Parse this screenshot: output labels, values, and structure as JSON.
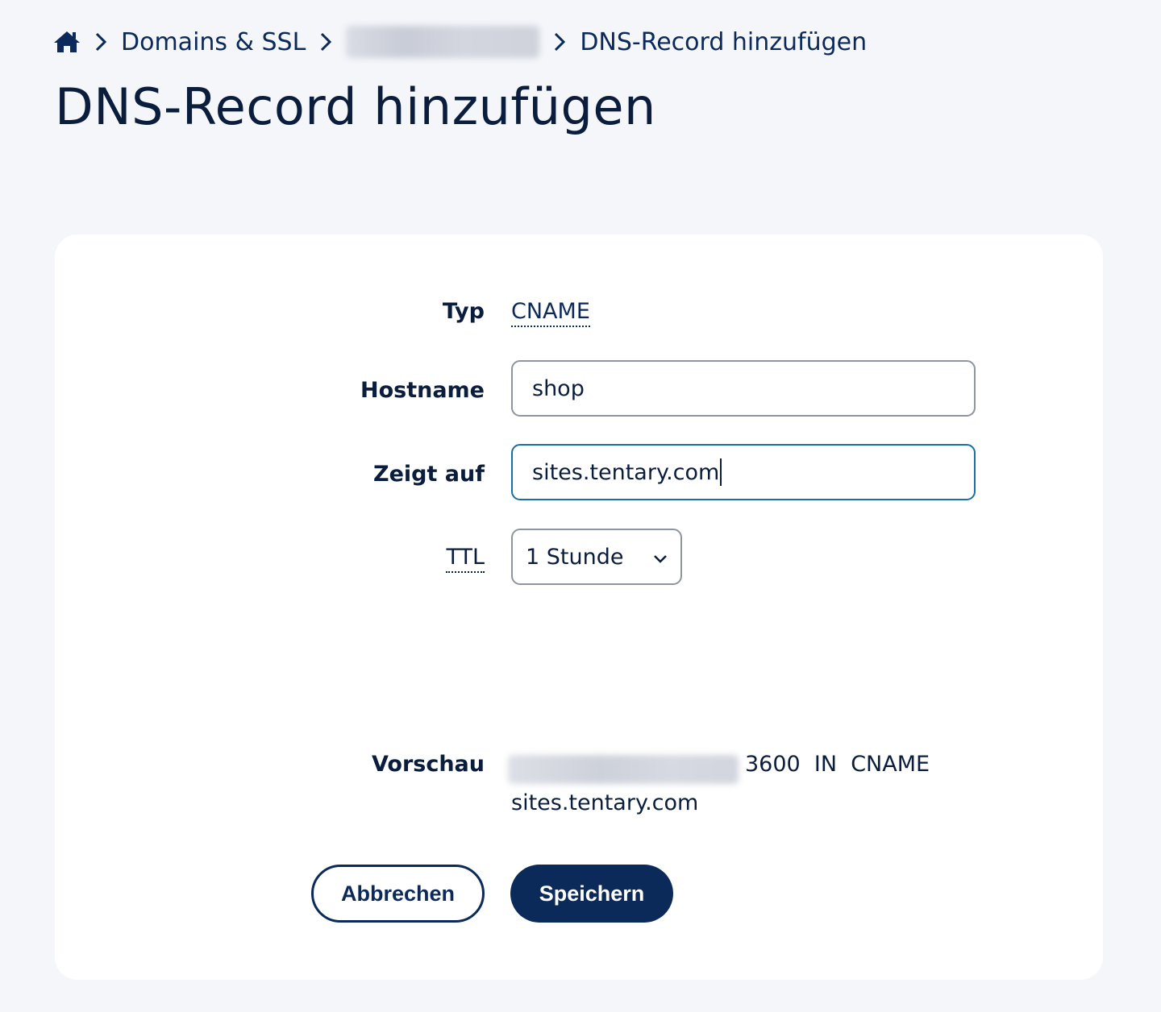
{
  "breadcrumb": {
    "home_icon": "home-icon",
    "separator_icon": "chevron-right-icon",
    "items": [
      "Domains & SSL",
      "DNS-Record hinzufügen"
    ]
  },
  "page_title": "DNS-Record hinzufügen",
  "form": {
    "type": {
      "label": "Typ",
      "value": "CNAME"
    },
    "hostname": {
      "label": "Hostname",
      "value": "shop"
    },
    "target": {
      "label": "Zeigt auf",
      "value": "sites.tentary.com"
    },
    "ttl": {
      "label": "TTL",
      "value": "1 Stunde",
      "icon": "chevron-down-icon"
    },
    "preview": {
      "label": "Vorschau",
      "line1": "3600  IN  CNAME",
      "line2": "sites.tentary.com"
    }
  },
  "buttons": {
    "cancel": "Abbrechen",
    "save": "Speichern"
  },
  "colors": {
    "background": "#f4f6fa",
    "primary": "#0b2a5a",
    "focus_border": "#1a6ea8"
  }
}
